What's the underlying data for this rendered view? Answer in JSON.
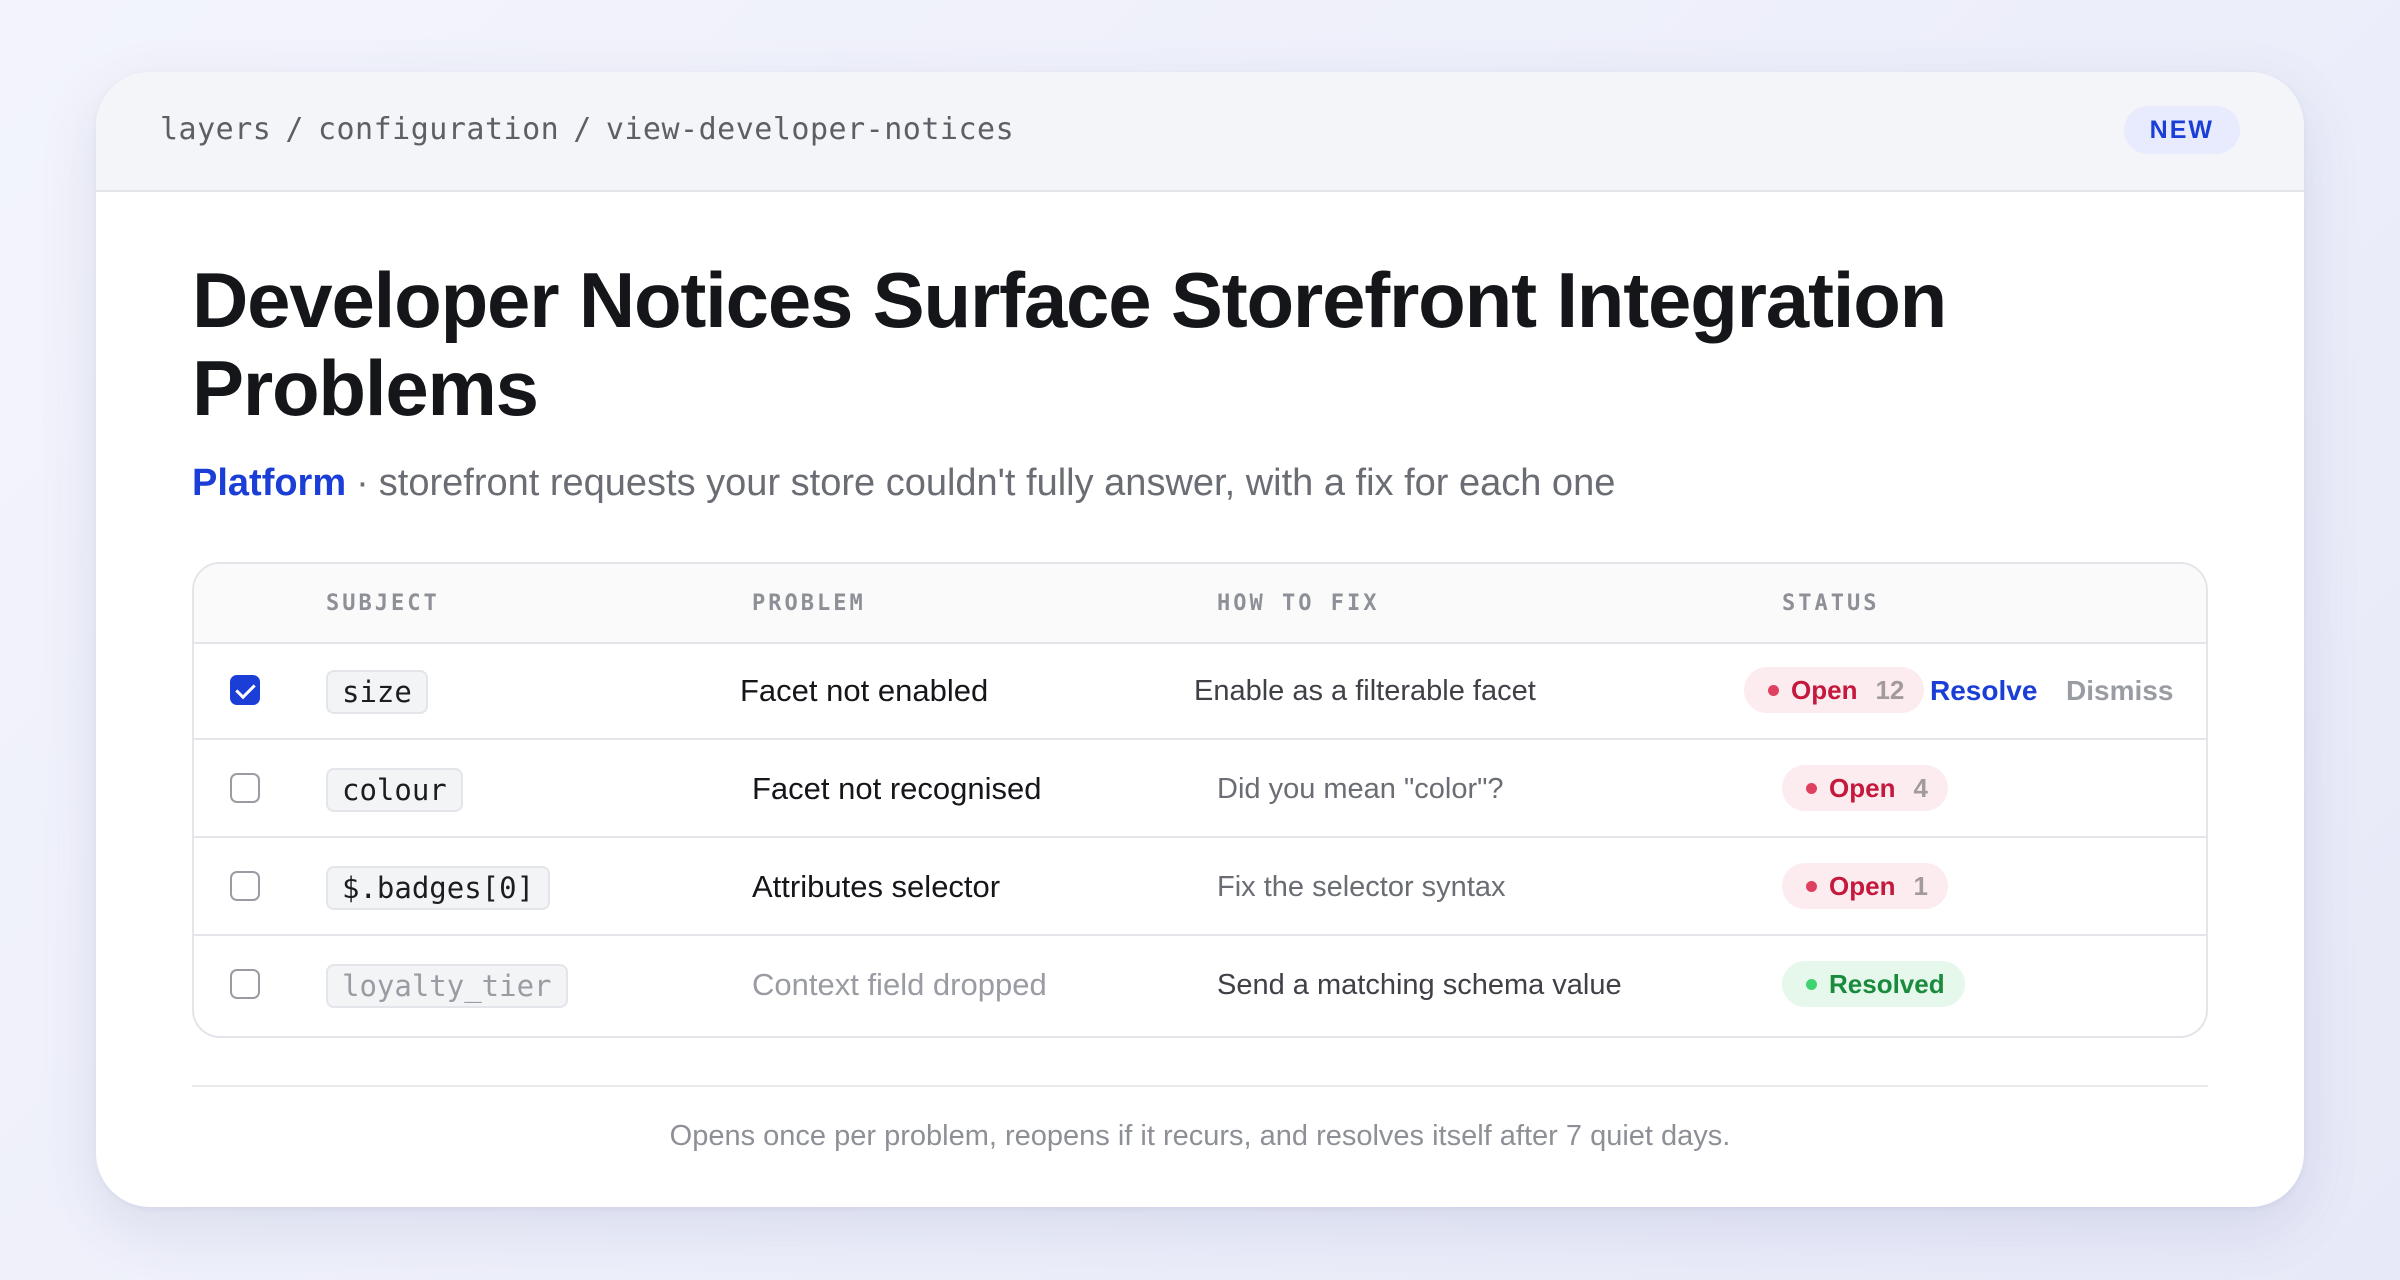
{
  "breadcrumb": {
    "part1": "layers",
    "part2": "configuration",
    "part3": "view-developer-notices",
    "separator": "/"
  },
  "badge": "NEW",
  "title": "Developer Notices Surface Storefront Integration Problems",
  "subtitle": {
    "category": "Platform",
    "separator": "·",
    "text": "storefront requests your store couldn't fully answer, with a fix for each one"
  },
  "table": {
    "headers": {
      "subject": "SUBJECT",
      "problem": "PROBLEM",
      "fix": "HOW TO FIX",
      "status": "STATUS"
    },
    "rows": [
      {
        "checked": true,
        "subject": "size",
        "problem": "Facet not enabled",
        "fix": "Enable as a filterable facet",
        "status": "Open",
        "count": "12",
        "resolve_label": "Resolve",
        "dismiss_label": "Dismiss"
      },
      {
        "checked": false,
        "subject": "colour",
        "problem": "Facet not recognised",
        "fix": "Did you mean \"color\"?",
        "status": "Open",
        "count": "4"
      },
      {
        "checked": false,
        "subject": "$.badges[0]",
        "problem": "Attributes selector",
        "fix": "Fix the selector syntax",
        "status": "Open",
        "count": "1"
      },
      {
        "checked": false,
        "subject": "loyalty_tier",
        "problem": "Context field dropped",
        "fix": "Send a matching schema value",
        "status": "Resolved"
      }
    ]
  },
  "footer": "Opens once per problem, reopens if it recurs, and resolves itself after 7 quiet days.",
  "colors": {
    "accent": "#1b3fd6",
    "open": "#c4183d",
    "resolved": "#1a8a3c"
  }
}
